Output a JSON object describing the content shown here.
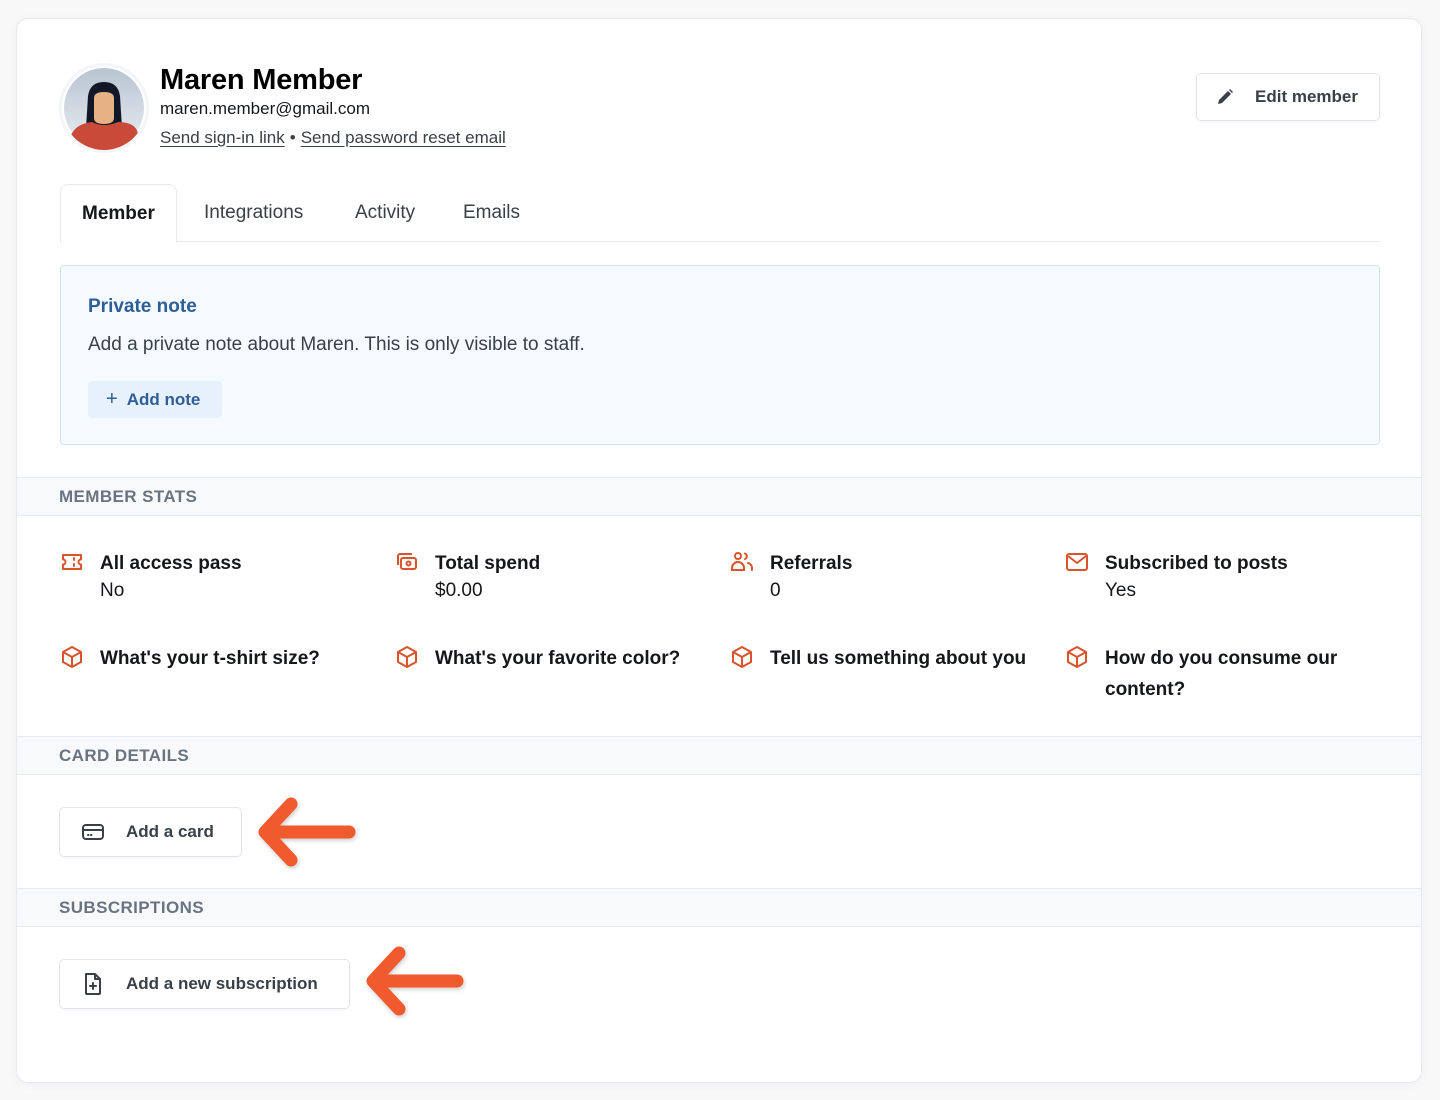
{
  "member": {
    "name": "Maren Member",
    "email": "maren.member@gmail.com",
    "send_signin_link": "Send sign-in link",
    "separator": "•",
    "send_password_reset": "Send password reset email",
    "edit_button": "Edit member"
  },
  "tabs": [
    {
      "label": "Member",
      "active": true
    },
    {
      "label": "Integrations",
      "active": false
    },
    {
      "label": "Activity",
      "active": false
    },
    {
      "label": "Emails",
      "active": false
    }
  ],
  "private_note": {
    "title": "Private note",
    "description": "Add a private note about Maren. This is only visible to staff.",
    "add_button": "Add note",
    "add_icon": "+"
  },
  "sections": {
    "member_stats": "MEMBER STATS",
    "card_details": "CARD DETAILS",
    "subscriptions": "SUBSCRIPTIONS"
  },
  "stats": [
    {
      "icon": "ticket-icon",
      "label": "All access pass",
      "value": "No"
    },
    {
      "icon": "money-icon",
      "label": "Total spend",
      "value": "$0.00"
    },
    {
      "icon": "users-icon",
      "label": "Referrals",
      "value": "0"
    },
    {
      "icon": "mail-icon",
      "label": "Subscribed to posts",
      "value": "Yes"
    },
    {
      "icon": "cube-icon",
      "label": "What's your t-shirt size?",
      "value": ""
    },
    {
      "icon": "cube-icon",
      "label": "What's your favorite color?",
      "value": ""
    },
    {
      "icon": "cube-icon",
      "label": "Tell us something about you",
      "value": ""
    },
    {
      "icon": "cube-icon",
      "label": "How do you consume our content?",
      "value": ""
    }
  ],
  "card_details": {
    "add_button": "Add a card"
  },
  "subscriptions": {
    "add_button": "Add a new subscription"
  },
  "colors": {
    "accent_orange": "#d9532c",
    "annotation_arrow": "#f05a2c",
    "note_blue": "#2e5e97"
  }
}
